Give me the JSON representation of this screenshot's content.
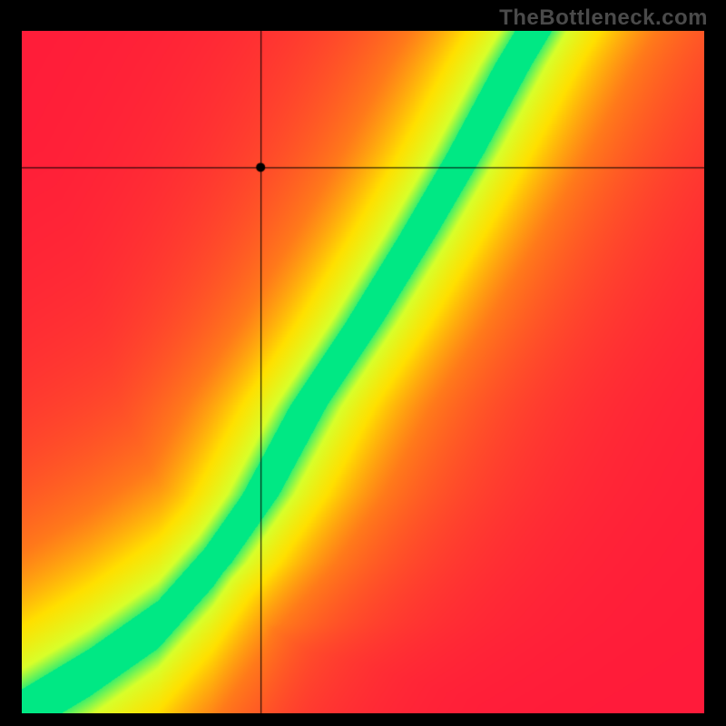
{
  "watermark": "TheBottleneck.com",
  "chart_data": {
    "type": "heatmap",
    "title": "",
    "xlabel": "",
    "ylabel": "",
    "xlim": [
      0,
      1
    ],
    "ylim": [
      0,
      1
    ],
    "crosshair": {
      "x": 0.35,
      "y": 0.8
    },
    "optimal_band": {
      "description": "green optimal zone following a superlinear curve from bottom-left toward upper-right",
      "points": [
        {
          "x": 0.0,
          "y": 0.0
        },
        {
          "x": 0.1,
          "y": 0.06
        },
        {
          "x": 0.2,
          "y": 0.13
        },
        {
          "x": 0.28,
          "y": 0.22
        },
        {
          "x": 0.35,
          "y": 0.32
        },
        {
          "x": 0.42,
          "y": 0.45
        },
        {
          "x": 0.5,
          "y": 0.57
        },
        {
          "x": 0.58,
          "y": 0.7
        },
        {
          "x": 0.65,
          "y": 0.82
        },
        {
          "x": 0.72,
          "y": 0.95
        },
        {
          "x": 0.78,
          "y": 1.05
        }
      ],
      "band_halfwidth": 0.035
    },
    "color_stops": [
      {
        "t": 0.0,
        "color": "#ff1a3a"
      },
      {
        "t": 0.35,
        "color": "#ff7a1a"
      },
      {
        "t": 0.6,
        "color": "#ffe000"
      },
      {
        "t": 0.82,
        "color": "#d8ff2a"
      },
      {
        "t": 1.0,
        "color": "#00e884"
      }
    ]
  }
}
